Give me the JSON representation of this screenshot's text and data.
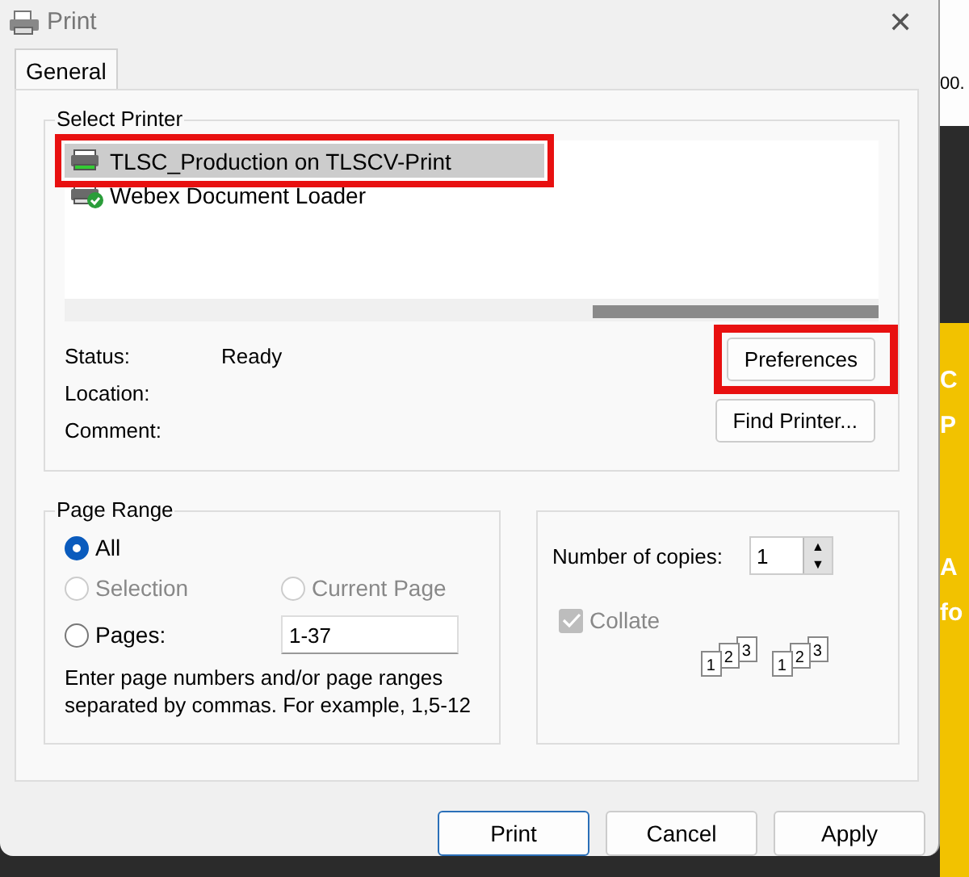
{
  "window": {
    "title": "Print",
    "close": "✕"
  },
  "tabs": [
    {
      "label": "General",
      "selected": true
    }
  ],
  "select_printer": {
    "label": "Select Printer",
    "printers": [
      {
        "name": "TLSC_Production on TLSCV-Print",
        "selected": true,
        "highlighted": true,
        "default": false
      },
      {
        "name": "Webex Document Loader",
        "selected": false,
        "highlighted": false,
        "default": true
      }
    ],
    "info": [
      {
        "label": "Status:",
        "value": "Ready"
      },
      {
        "label": "Location:"
      },
      {
        "label": "Comment:"
      }
    ],
    "buttons": [
      {
        "label": "Preferences",
        "highlighted": true
      },
      {
        "label": "Find Printer...",
        "highlighted": false
      }
    ]
  },
  "page_range": {
    "label": "Page Range",
    "options": [
      {
        "label": "All",
        "selected": true,
        "disabled": false
      },
      {
        "label": "Selection",
        "selected": false,
        "disabled": true
      },
      {
        "label": "Current Page",
        "selected": false,
        "disabled": true
      },
      {
        "label": "Pages:",
        "selected": false,
        "disabled": false
      }
    ],
    "pages_value": "1-37",
    "hint": "Enter page numbers and/or page ranges separated by commas.  For example, 1,5-12"
  },
  "copies": {
    "label": "Number of copies:",
    "value": "1",
    "arrows": [
      "▲",
      "▼"
    ],
    "collate": {
      "label": "Collate",
      "checked": true,
      "disabled": true
    },
    "collate_sets": [
      [
        "1",
        "2",
        "3"
      ],
      [
        "1",
        "2",
        "3"
      ]
    ]
  },
  "buttons": [
    {
      "label": "Print",
      "default": true
    },
    {
      "label": "Cancel",
      "default": false
    },
    {
      "label": "Apply",
      "default": false
    }
  ],
  "background": {
    "top_text": "00.",
    "yellow_texts": [
      "C",
      "P",
      "A",
      "fo"
    ]
  }
}
